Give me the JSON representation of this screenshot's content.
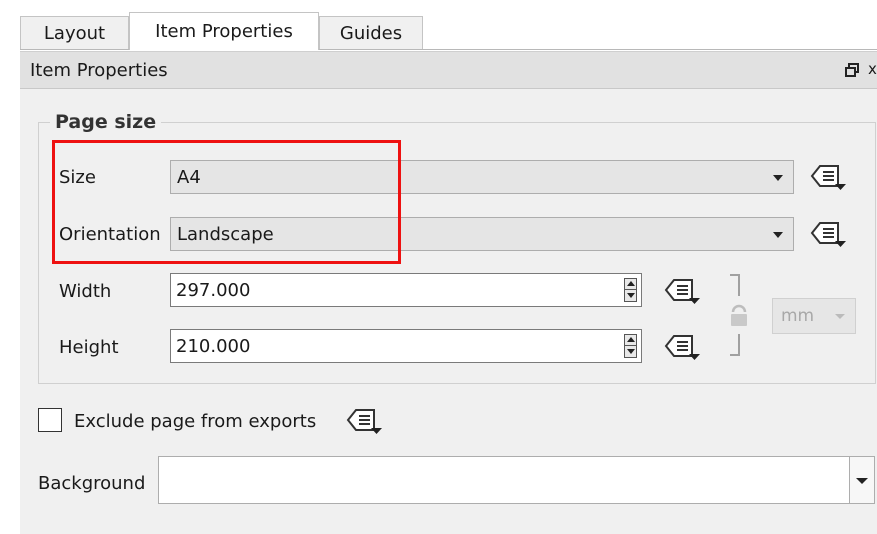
{
  "tabs": [
    {
      "label": "Layout"
    },
    {
      "label": "Item Properties"
    },
    {
      "label": "Guides"
    }
  ],
  "panel": {
    "title": "Item Properties",
    "close_symbol": "x"
  },
  "page_size": {
    "group_title": "Page size",
    "size": {
      "label": "Size",
      "value": "A4"
    },
    "orientation": {
      "label": "Orientation",
      "value": "Landscape"
    },
    "width": {
      "label": "Width",
      "value": "297.000"
    },
    "height": {
      "label": "Height",
      "value": "210.000"
    },
    "unit": {
      "value": "mm"
    }
  },
  "exclude": {
    "label": "Exclude page from exports",
    "checked": false
  },
  "background": {
    "label": "Background",
    "value": ""
  },
  "icons": {
    "data_defined": "data-defined-override-icon",
    "lock": "lock-ratio-icon",
    "float": "float-panel-icon",
    "close": "close-icon"
  },
  "colors": {
    "highlight": "#ee1111",
    "panel_bg": "#f0f0f0"
  }
}
